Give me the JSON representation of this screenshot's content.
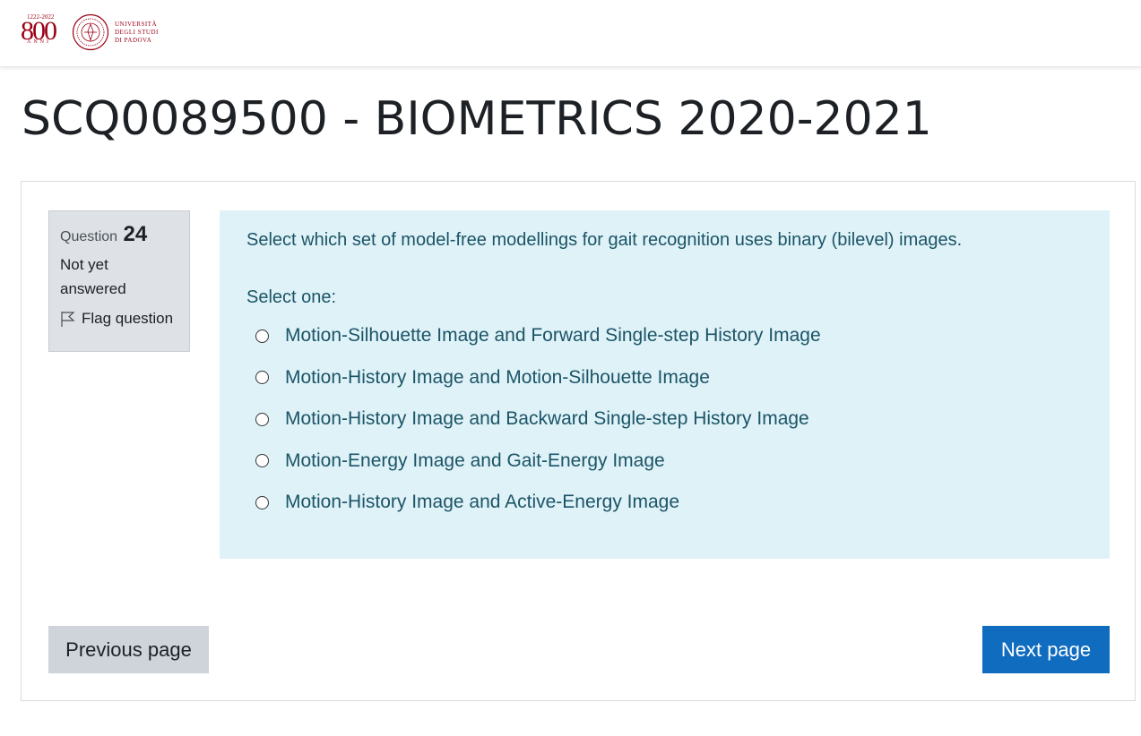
{
  "header": {
    "logo": {
      "anniversary_number": "800",
      "anniversary_years": "1222-2022",
      "anniversary_word": "ANNI",
      "university_lines": [
        "UNIVERSITÀ",
        "DEGLI STUDI",
        "DI PADOVA"
      ],
      "brand_color": "#9b0014"
    }
  },
  "page": {
    "title": "SCQ0089500 - BIOMETRICS 2020-2021"
  },
  "question": {
    "label": "Question",
    "number": "24",
    "state": "Not yet answered",
    "flag_label": "Flag question",
    "text": "Select which set of model-free modellings for gait recognition uses binary (bilevel) images.",
    "prompt": "Select one:",
    "answers": [
      "Motion-Silhouette Image and Forward Single-step History Image",
      "Motion-History Image and Motion-Silhouette Image",
      "Motion-History Image and Backward Single-step History Image",
      "Motion-Energy Image and Gait-Energy Image",
      "Motion-History Image and Active-Energy Image"
    ]
  },
  "navigation": {
    "previous_label": "Previous page",
    "next_label": "Next page"
  },
  "colors": {
    "question_bg": "#def2f8",
    "info_bg": "#dee2e6",
    "primary": "#0f6cbf",
    "secondary": "#ced4da",
    "question_text": "#1c5466"
  }
}
